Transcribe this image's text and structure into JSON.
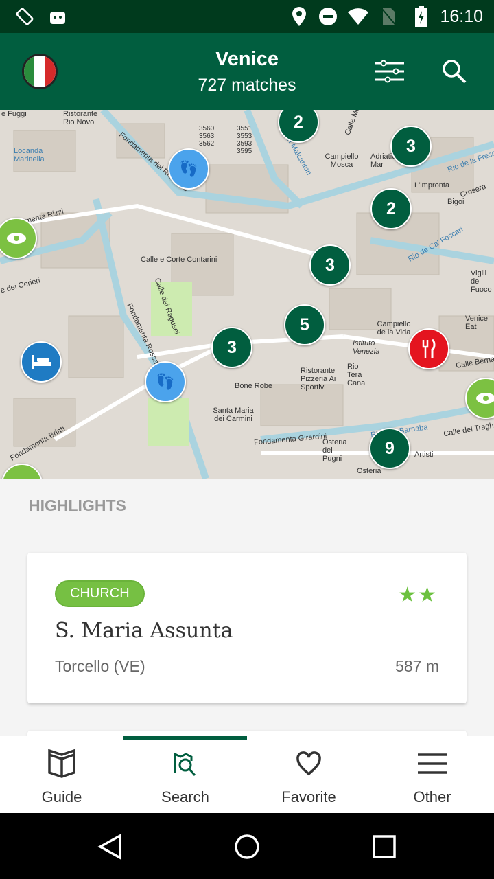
{
  "status_bar": {
    "time": "16:10",
    "icons": [
      "screen-rotation-icon",
      "android-icon",
      "location-icon",
      "do-not-disturb-icon",
      "wifi-icon",
      "no-sim-icon",
      "battery-charging-icon"
    ]
  },
  "app_bar": {
    "title": "Venice",
    "subtitle": "727 matches",
    "icons": [
      "app-logo",
      "filter-sliders-icon",
      "search-icon"
    ]
  },
  "map": {
    "labels": [
      {
        "t": "e Fuggi"
      },
      {
        "t": "Ristorante Rio Novo"
      },
      {
        "t": "Locanda Marinella"
      },
      {
        "t": "Fondamenta del Rio Novo"
      },
      {
        "t": "3560 3563 3562"
      },
      {
        "t": "3551 3553 3593 3595"
      },
      {
        "t": "Rio del Malcanton",
        "w": true
      },
      {
        "t": "Campiello Mosca"
      },
      {
        "t": "Calle Mo"
      },
      {
        "t": "Adriatico Mar"
      },
      {
        "t": "Rio de la Frescada",
        "w": true
      },
      {
        "t": "L'impronta"
      },
      {
        "t": "Bigoi"
      },
      {
        "t": "Crosera"
      },
      {
        "t": "Rio de Ca' Foscari",
        "w": true
      },
      {
        "t": "amenta Rizzi"
      },
      {
        "t": "Calle e Corte Contarini"
      },
      {
        "t": "e dei Cerieri"
      },
      {
        "t": "Calle dei Ragusei"
      },
      {
        "t": "Fondamenta Rossa"
      },
      {
        "t": "Campiello de la Vida"
      },
      {
        "t": "Istituto Venezia"
      },
      {
        "t": "Rio Terà Canal"
      },
      {
        "t": "Ristorante Pizzeria Ai Sportivi"
      },
      {
        "t": "Bone Robe"
      },
      {
        "t": "Santa Maria dei Carmini"
      },
      {
        "t": "Fondamenta Briati"
      },
      {
        "t": "Fondamenta Girardini"
      },
      {
        "t": "Rio San Barnaba",
        "w": true
      },
      {
        "t": "Osteria dei Pugni"
      },
      {
        "t": "Calle Berna"
      },
      {
        "t": "Calle del Tragh"
      },
      {
        "t": "Vigili del Fuoco"
      },
      {
        "t": "Venice Eat"
      },
      {
        "t": "Artisti"
      },
      {
        "t": "Osteria"
      }
    ],
    "clusters": [
      {
        "count": "2"
      },
      {
        "count": "3"
      },
      {
        "count": "2"
      },
      {
        "count": "3"
      },
      {
        "count": "5"
      },
      {
        "count": "3"
      },
      {
        "count": "9"
      }
    ],
    "pois": [
      {
        "type": "walking-tour",
        "color": "#4ba3ec"
      },
      {
        "type": "walking-tour",
        "color": "#4ba3ec"
      },
      {
        "type": "sight",
        "color": "#7cc142"
      },
      {
        "type": "sight",
        "color": "#7cc142"
      },
      {
        "type": "sight",
        "color": "#7cc142"
      },
      {
        "type": "hotel",
        "color": "#1f7bc3"
      },
      {
        "type": "restaurant",
        "color": "#e4141f"
      }
    ]
  },
  "highlights": {
    "heading": "HIGHLIGHTS",
    "cards": [
      {
        "category": "CHURCH",
        "stars": "★★",
        "rating": 2,
        "name": "S. Maria Assunta",
        "place": "Torcello (VE)",
        "distance": "587 m"
      }
    ]
  },
  "bottom_nav": {
    "active": "Search",
    "items": [
      {
        "label": "Guide",
        "icon": "book-icon"
      },
      {
        "label": "Search",
        "icon": "map-search-icon"
      },
      {
        "label": "Favorite",
        "icon": "heart-icon"
      },
      {
        "label": "Other",
        "icon": "menu-icon"
      }
    ]
  },
  "colors": {
    "primary": "#015e3f",
    "status": "#003a1d",
    "accent": "#76c043"
  }
}
